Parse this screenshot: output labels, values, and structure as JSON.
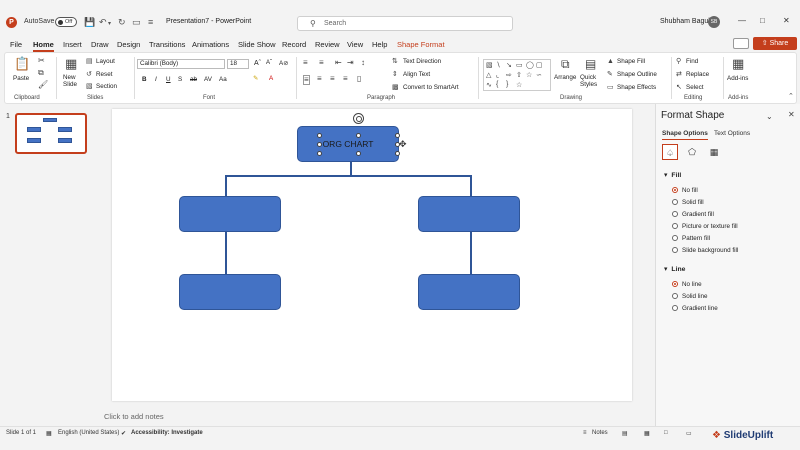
{
  "app": {
    "autosave_label": "AutoSave",
    "autosave_state": "Off",
    "document_title": "Presentation7  -  PowerPoint",
    "search_placeholder": "Search",
    "user_name": "Shubham Bagul",
    "user_initials": "SB"
  },
  "menu": {
    "tabs": [
      "File",
      "Home",
      "Insert",
      "Draw",
      "Design",
      "Transitions",
      "Animations",
      "Slide Show",
      "Record",
      "Review",
      "View",
      "Help",
      "Shape Format"
    ],
    "active_tab": "Home",
    "contextual_tab": "Shape Format",
    "share_label": "Share"
  },
  "ribbon": {
    "clipboard": {
      "paste": "Paste",
      "label": "Clipboard"
    },
    "slides": {
      "new_slide": "New Slide",
      "layout": "Layout",
      "reset": "Reset",
      "section": "Section",
      "label": "Slides"
    },
    "font": {
      "name": "Calibri (Body)",
      "size": "18",
      "label": "Font"
    },
    "paragraph": {
      "text_direction": "Text Direction",
      "align_text": "Align Text",
      "convert_smartart": "Convert to SmartArt",
      "label": "Paragraph"
    },
    "drawing": {
      "arrange": "Arrange",
      "quick_styles": "Quick Styles",
      "shape_fill": "Shape Fill",
      "shape_outline": "Shape Outline",
      "shape_effects": "Shape Effects",
      "label": "Drawing"
    },
    "editing": {
      "find": "Find",
      "replace": "Replace",
      "select": "Select",
      "label": "Editing"
    },
    "addins": {
      "addins": "Add-ins",
      "label": "Add-ins"
    }
  },
  "thumbnail": {
    "slide_number": "1"
  },
  "slide": {
    "title_text": "ORG CHART",
    "notes_placeholder": "Click to add notes"
  },
  "format_pane": {
    "title": "Format Shape",
    "tabs": [
      "Shape Options",
      "Text Options"
    ],
    "fill_header": "Fill",
    "fill_options": [
      "No fill",
      "Solid fill",
      "Gradient fill",
      "Picture or texture fill",
      "Pattern fill",
      "Slide background fill"
    ],
    "fill_selected": "No fill",
    "line_header": "Line",
    "line_options": [
      "No line",
      "Solid line",
      "Gradient line"
    ],
    "line_selected": "No line"
  },
  "status": {
    "slide_info": "Slide 1 of 1",
    "language": "English (United States)",
    "accessibility": "Accessibility: Investigate",
    "notes": "Notes"
  },
  "watermark": {
    "text": "SlideUplift"
  },
  "colors": {
    "accent": "#c43e1c",
    "shape_fill": "#4472c4",
    "shape_border": "#2f5597"
  }
}
